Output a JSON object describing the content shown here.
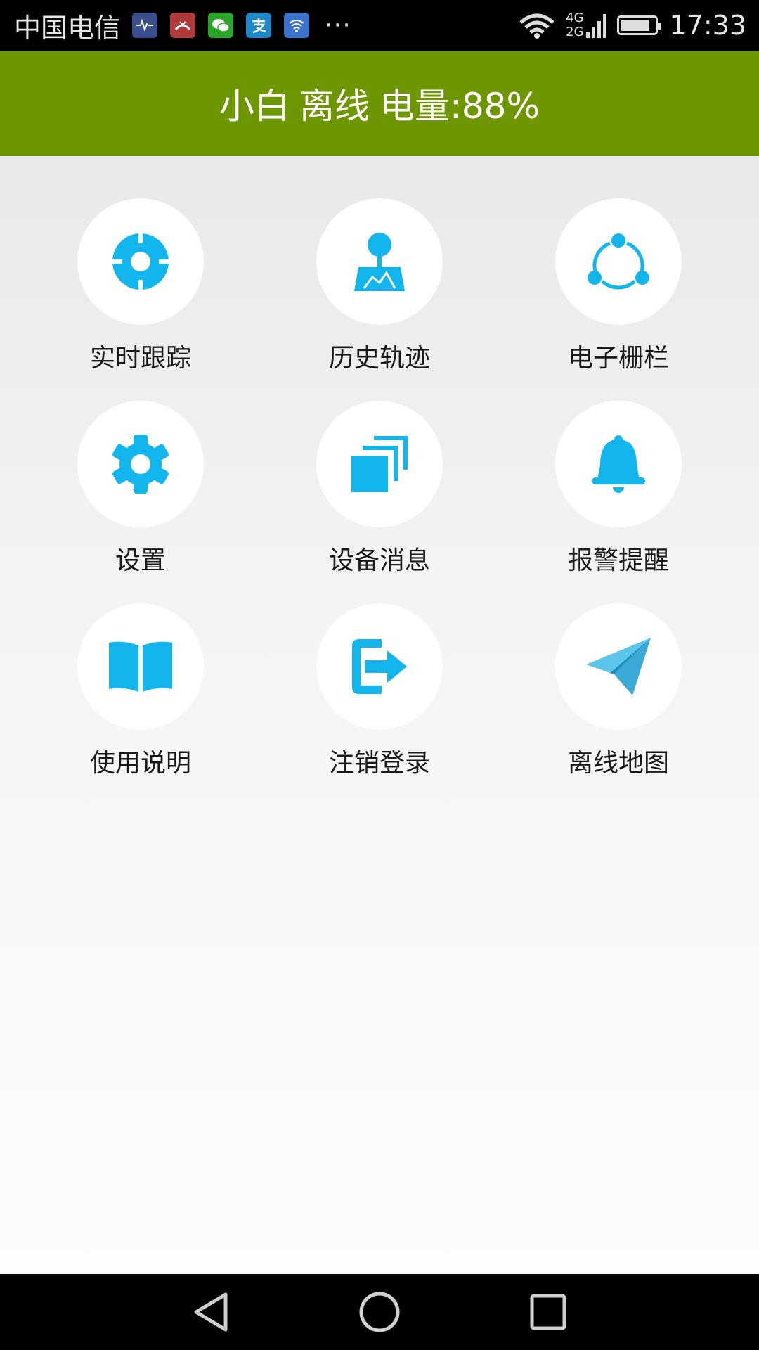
{
  "status_bar": {
    "carrier": "中国电信",
    "more": "···",
    "network_top": "4G",
    "network_bottom": "2G",
    "battery_level": 0.88,
    "time": "17:33"
  },
  "header": {
    "device_name": "小白",
    "status": "离线",
    "battery_text": "电量:88%",
    "color": "#6e9600"
  },
  "accent_color": "#12b6ec",
  "menu": [
    {
      "label": "实时跟踪",
      "icon": "crosshair-icon"
    },
    {
      "label": "历史轨迹",
      "icon": "map-pin-icon"
    },
    {
      "label": "电子栅栏",
      "icon": "share-icon"
    },
    {
      "label": "设置",
      "icon": "gear-icon"
    },
    {
      "label": "设备消息",
      "icon": "stacked-pages-icon"
    },
    {
      "label": "报警提醒",
      "icon": "bell-icon"
    },
    {
      "label": "使用说明",
      "icon": "book-icon"
    },
    {
      "label": "注销登录",
      "icon": "logout-icon"
    },
    {
      "label": "离线地图",
      "icon": "paper-plane-icon"
    }
  ]
}
